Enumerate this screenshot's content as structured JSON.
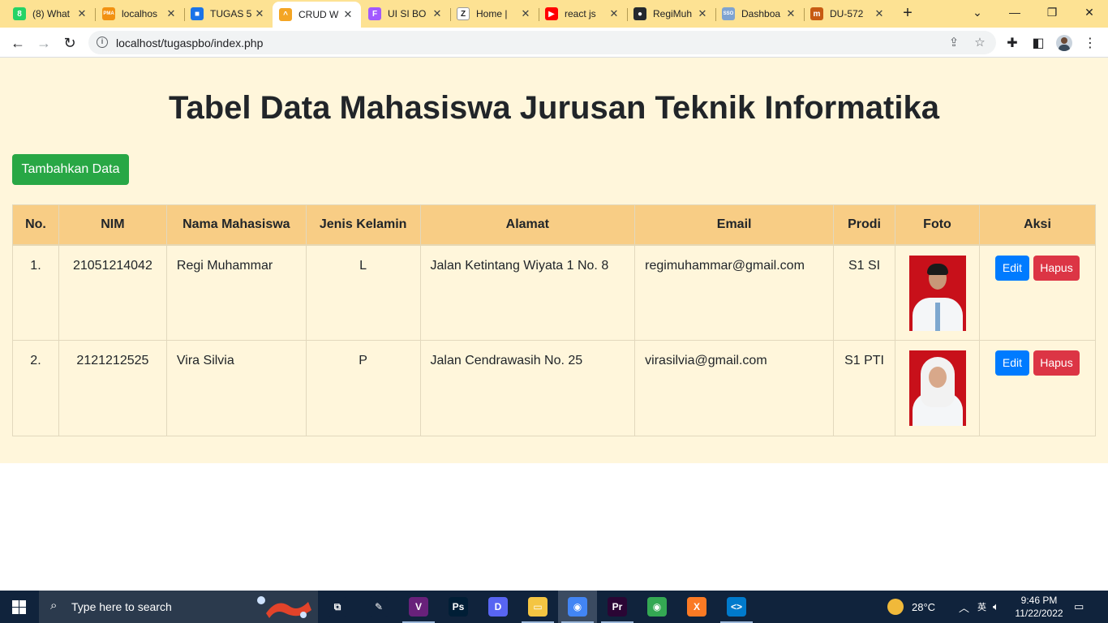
{
  "browser": {
    "tabs": [
      {
        "title": "(8) What",
        "icon": "whatsapp-icon",
        "color": "#25d366",
        "glyph": "8"
      },
      {
        "title": "localhos",
        "icon": "pma-icon",
        "color": "#f29111",
        "glyph": "PMA"
      },
      {
        "title": "TUGAS 5",
        "icon": "classroom-icon",
        "color": "#1a73e8",
        "glyph": "■"
      },
      {
        "title": "CRUD W",
        "icon": "crud-icon",
        "color": "#f4a524",
        "glyph": "^"
      },
      {
        "title": "UI SI BO",
        "icon": "figma-icon",
        "color": "#a259ff",
        "glyph": "F"
      },
      {
        "title": "Home | ",
        "icon": "zoho-icon",
        "color": "#ffffff",
        "glyph": "Z"
      },
      {
        "title": "react js",
        "icon": "youtube-icon",
        "color": "#ff0000",
        "glyph": "▶"
      },
      {
        "title": "RegiMuh",
        "icon": "github-icon",
        "color": "#24292e",
        "glyph": "●"
      },
      {
        "title": "Dashboa",
        "icon": "sso-icon",
        "color": "#7fa3d1",
        "glyph": "SSO"
      },
      {
        "title": "DU-572",
        "icon": "db-icon",
        "color": "#c75b12",
        "glyph": "m"
      }
    ],
    "active_tab": 3,
    "url": "localhost/tugaspbo/index.php"
  },
  "page": {
    "title": "Tabel Data Mahasiswa Jurusan Teknik Informatika",
    "add_button": "Tambahkan Data",
    "columns": [
      "No.",
      "NIM",
      "Nama Mahasiswa",
      "Jenis Kelamin",
      "Alamat",
      "Email",
      "Prodi",
      "Foto",
      "Aksi"
    ],
    "rows": [
      {
        "no": "1.",
        "nim": "21051214042",
        "nama": "Regi Muhammar",
        "jk": "L",
        "alamat": "Jalan Ketintang Wiyata 1 No. 8",
        "email": "regimuhammar@gmail.com",
        "prodi": "S1 SI",
        "foto": "photo-male",
        "edit": "Edit",
        "hapus": "Hapus"
      },
      {
        "no": "2.",
        "nim": "2121212525",
        "nama": "Vira Silvia",
        "jk": "P",
        "alamat": "Jalan Cendrawasih No. 25",
        "email": "virasilvia@gmail.com",
        "prodi": "S1 PTI",
        "foto": "photo-female",
        "edit": "Edit",
        "hapus": "Hapus"
      }
    ]
  },
  "taskbar": {
    "search_placeholder": "Type here to search",
    "weather": "28°C",
    "time": "9:46 PM",
    "date": "11/22/2022",
    "apps": [
      {
        "name": "task-view-icon",
        "color": "#10233c",
        "glyph": "⧉"
      },
      {
        "name": "paint-icon",
        "color": "#10233c",
        "glyph": "✎"
      },
      {
        "name": "visual-studio-icon",
        "color": "#68217a",
        "glyph": "V"
      },
      {
        "name": "photoshop-icon",
        "color": "#001e36",
        "glyph": "Ps"
      },
      {
        "name": "discord-icon",
        "color": "#5865f2",
        "glyph": "D"
      },
      {
        "name": "file-explorer-icon",
        "color": "#f4c542",
        "glyph": "▭"
      },
      {
        "name": "chrome-icon",
        "color": "#4285f4",
        "glyph": "◉"
      },
      {
        "name": "premiere-icon",
        "color": "#2a0634",
        "glyph": "Pr"
      },
      {
        "name": "chrome-icon-2",
        "color": "#34a853",
        "glyph": "◉"
      },
      {
        "name": "xampp-icon",
        "color": "#fb7a24",
        "glyph": "X"
      },
      {
        "name": "vscode-icon",
        "color": "#007acc",
        "glyph": "<>"
      }
    ]
  }
}
